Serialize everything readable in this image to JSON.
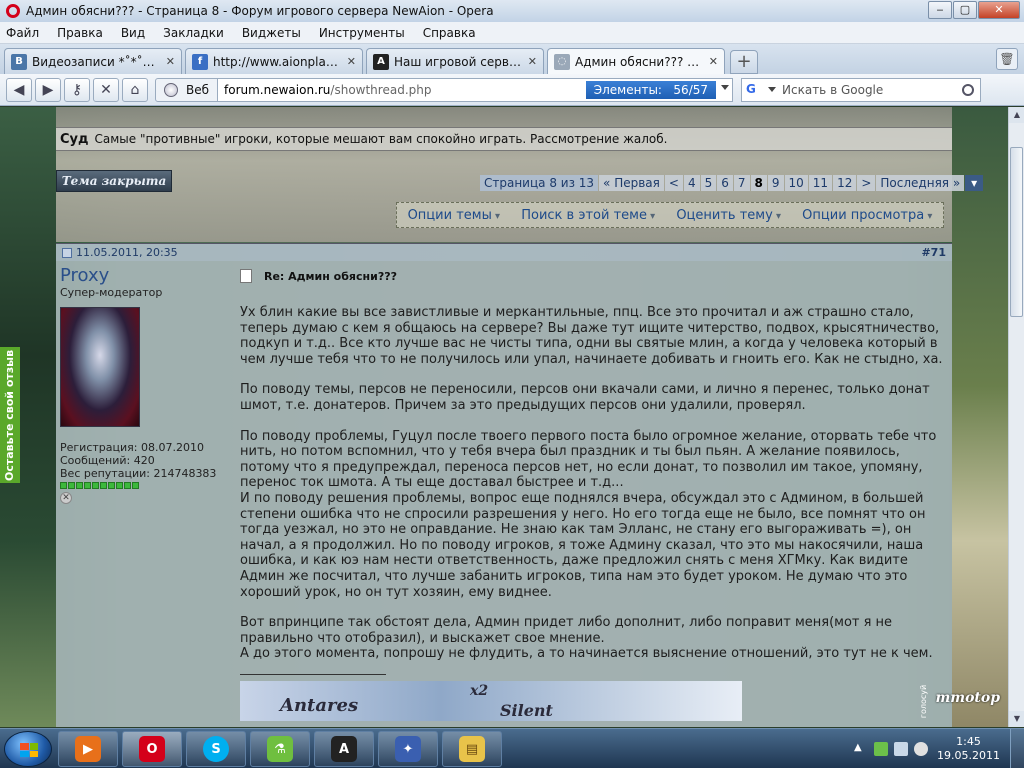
{
  "window": {
    "title": "Админ обясни??? - Страница 8 - Форум игрового сервера NewAion - Opera",
    "controls": {
      "minimize": "‒",
      "maximize": "▢",
      "close": "✕"
    }
  },
  "menu": [
    "Файл",
    "Правка",
    "Вид",
    "Закладки",
    "Виджеты",
    "Инструменты",
    "Справка"
  ],
  "tabs": [
    {
      "label": "Видеозаписи *˚*˚*˚*˚t...",
      "icon": "vk-icon",
      "color": "#4a76a8",
      "glyph": "B",
      "active": false
    },
    {
      "label": "http://www.aionplanet....",
      "icon": "aionplanet-icon",
      "color": "#3a6fc4",
      "glyph": "f",
      "active": false
    },
    {
      "label": "Наш игровой сервер ...",
      "icon": "aion-icon",
      "color": "#222222",
      "glyph": "A",
      "active": false
    },
    {
      "label": "Админ обясни??? - Стр...",
      "icon": "loading-icon",
      "color": "#9aa8b8",
      "glyph": "◌",
      "active": true
    }
  ],
  "newtab": "+",
  "nav": {
    "back": "◀",
    "forward": "▶",
    "key": "⚷",
    "stop": "✕",
    "home": "⌂",
    "site_label": "Веб",
    "url_domain": "forum.newaion.ru",
    "url_path": "/showthread.php",
    "elements_label": "Элементы:",
    "elements_count": "56/57",
    "search_placeholder": "Искать в Google"
  },
  "forum": {
    "section_title": "Суд",
    "section_desc": "Самые \"противные\" игроки, которые мешают вам спокойно играть. Рассмотрение жалоб.",
    "closed_label": "Тема закрыта",
    "pager": {
      "label": "Страница 8 из 13",
      "first": "« Первая",
      "prev": "<",
      "pages": [
        "4",
        "5",
        "6",
        "7",
        "8",
        "9",
        "10",
        "11",
        "12"
      ],
      "current": "8",
      "next": ">",
      "last": "Последняя »"
    },
    "options": [
      "Опции темы",
      "Поиск в этой теме",
      "Оценить тему",
      "Опции просмотра"
    ]
  },
  "post": {
    "date": "11.05.2011, 20:35",
    "number": "#71",
    "username": "Proxy",
    "usertitle": "Супер-модератор",
    "registration": "Регистрация: 08.07.2010",
    "messages": "Сообщений: 420",
    "reputation": "Вес репутации: 214748383",
    "rep_pips": 10,
    "title": "Re: Админ обясни???",
    "paragraphs": [
      "Ух блин какие вы все завистливые и меркантильные, ппц. Все это прочитал и аж страшно стало, теперь думаю с кем я общаюсь на сервере? Вы даже тут ищите читерство, подвох, крысятничество, подкуп и т.д.. Все кто лучше вас не чисты типа, одни вы святые млин, а когда у человека который в чем лучше тебя что то не получилось или упал, начинаете добивать и гноить его. Как не стыдно, ха.",
      "По поводу темы, персов не переносили, персов они вкачали сами, и лично я перенес, только донат шмот, т.е. донатеров. Причем за это предыдущих персов они удалили, проверял.",
      "По поводу проблемы, Гуцул после твоего первого поста было огромное желание, оторвать тебе что нить, но потом вспомнил, что у тебя вчера был праздник и ты был пьян. А желание появилось, потому что я предупреждал, переноса персов нет, но если донат, то позволил им такое, упомяну, перенос ток шмота. А ты еще доставал быстрее и т.д...",
      "И по поводу решения проблемы, вопрос еще поднялся вчера, обсуждал это с Админом, в большей степени ошибка что не спросили разрешения у него. Но его тогда еще не было, все помнят что он тогда уезжал, но это не оправдание. Не знаю как там Элланс, не стану его выгораживать =), он начал, а я продолжил. Но по поводу игроков, я тоже Админу сказал, что это мы накосячили, наша ошибка, и как юэ нам нести ответственность, даже предложил снять с меня ХГМку. Как видите Админ же посчитал, что лучше забанить игроков, типа нам это будет уроком. Не думаю что это хороший урок, но он тут хозяин, ему виднее.",
      "Вот впринципе так обстоят дела, Админ придет либо дополнит, либо поправит меня(мот я не правильно что отобразил), и выскажет свое мнение.",
      "А до этого момента, попрошу не флудить, а то начинается выяснение отношений, это тут не к чем."
    ],
    "sig_text": [
      "Antares",
      "x2",
      "Silent"
    ]
  },
  "feedback_label": "Оставьте свой отзыв",
  "mmotop": {
    "brand": "mmotop",
    "vote": "голосуй"
  },
  "taskbar": {
    "apps": [
      {
        "name": "media-player",
        "color": "#e8701a",
        "glyph": "▶",
        "active": false
      },
      {
        "name": "opera",
        "color": "#d4001a",
        "glyph": "O",
        "active": true
      },
      {
        "name": "skype",
        "color": "#00aff0",
        "glyph": "S",
        "active": false
      },
      {
        "name": "network-tool",
        "color": "#6fbf3f",
        "glyph": "⚗",
        "active": false
      },
      {
        "name": "aion",
        "color": "#222222",
        "glyph": "A",
        "active": false
      },
      {
        "name": "game-launcher",
        "color": "#3a5fb0",
        "glyph": "✦",
        "active": false
      },
      {
        "name": "explorer",
        "color": "#e8c34a",
        "glyph": "▤",
        "active": false
      }
    ],
    "time": "1:45",
    "date": "19.05.2011"
  }
}
